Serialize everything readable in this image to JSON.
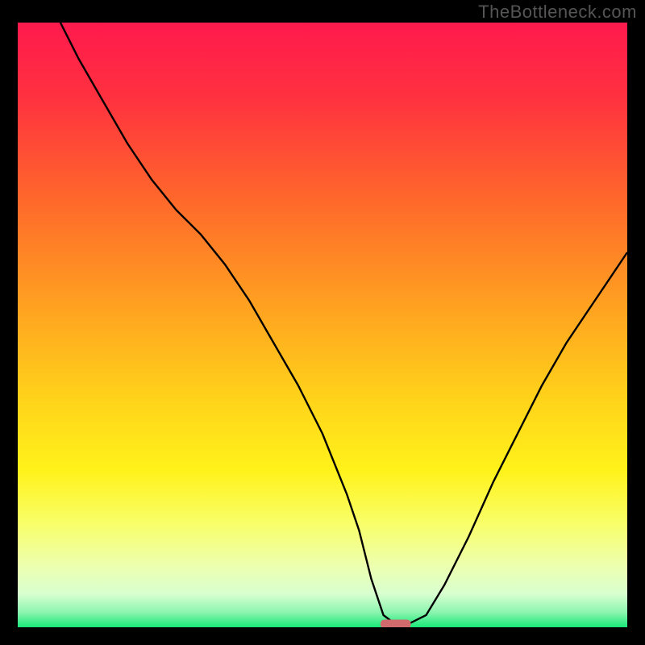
{
  "watermark": "TheBottleneck.com",
  "chart_data": {
    "type": "line",
    "title": "",
    "xlabel": "",
    "ylabel": "",
    "xlim": [
      0,
      100
    ],
    "ylim": [
      0,
      100
    ],
    "grid": false,
    "axes_visible": false,
    "background_gradient": {
      "stops": [
        {
          "offset": 0.0,
          "color": "#ff1a4d"
        },
        {
          "offset": 0.12,
          "color": "#ff3040"
        },
        {
          "offset": 0.3,
          "color": "#ff6a2a"
        },
        {
          "offset": 0.48,
          "color": "#ffa520"
        },
        {
          "offset": 0.62,
          "color": "#ffd21a"
        },
        {
          "offset": 0.74,
          "color": "#fff21a"
        },
        {
          "offset": 0.83,
          "color": "#f8ff6a"
        },
        {
          "offset": 0.9,
          "color": "#ecffb0"
        },
        {
          "offset": 0.945,
          "color": "#d8ffd0"
        },
        {
          "offset": 0.975,
          "color": "#8cf5b0"
        },
        {
          "offset": 1.0,
          "color": "#18e878"
        }
      ]
    },
    "series": [
      {
        "name": "bottleneck-curve",
        "color": "#000000",
        "x": [
          7,
          10,
          14,
          18,
          22,
          26,
          30,
          34,
          38,
          42,
          46,
          50,
          54,
          56,
          58,
          60,
          62,
          64,
          67,
          70,
          74,
          78,
          82,
          86,
          90,
          94,
          98,
          100
        ],
        "y": [
          100,
          94,
          87,
          80,
          74,
          69,
          65,
          60,
          54,
          47,
          40,
          32,
          22,
          16,
          8,
          2,
          0.5,
          0.5,
          2,
          7,
          15,
          24,
          32,
          40,
          47,
          53,
          59,
          62
        ]
      }
    ],
    "marker": {
      "name": "optimal-zone-marker",
      "x_center": 62,
      "width": 5,
      "y": 0.6,
      "color": "#d06a6d",
      "shape": "rounded-bar"
    }
  }
}
